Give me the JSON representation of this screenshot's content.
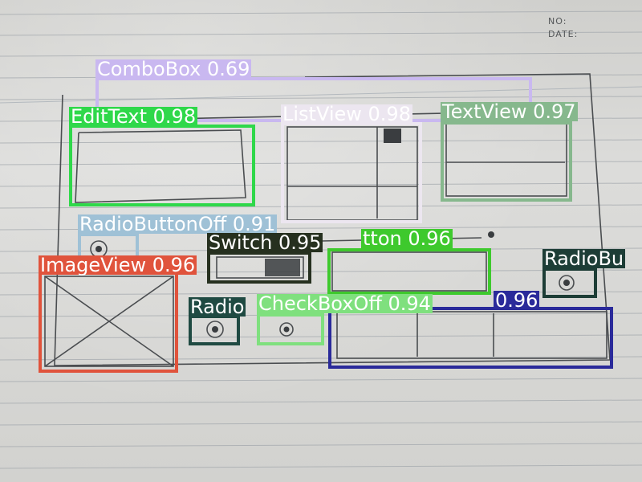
{
  "paper_header": {
    "no_label": "NO:",
    "date_label": "DATE:"
  },
  "detections": [
    {
      "id": "combobox",
      "label": "ComboBox",
      "score": "0.69",
      "text": "ComboBox 0.69",
      "color": "#c9b8f0",
      "text_color": "#ffffff"
    },
    {
      "id": "edittext",
      "label": "EditText",
      "score": "0.98",
      "text": "EditText 0.98",
      "color": "#2fd84a",
      "text_color": "#ffffff"
    },
    {
      "id": "listview",
      "label": "ListView",
      "score": "0.98",
      "text": "ListView 0.98",
      "color": "#ece6f0",
      "text_color": "#ffffff"
    },
    {
      "id": "textview",
      "label": "TextView",
      "score": "0.97",
      "text": "TextView 0.97",
      "color": "#86b88d",
      "text_color": "#ffffff"
    },
    {
      "id": "radiobuttonoff-top",
      "label": "RadioButtonOff",
      "score": "0.91",
      "text": "RadioButtonOff 0.91",
      "color": "#9fc1d6",
      "text_color": "#ffffff"
    },
    {
      "id": "switch",
      "label": "Switch",
      "score": "0.95",
      "text": "Switch 0.95",
      "color": "#26301f",
      "text_color": "#ffffff"
    },
    {
      "id": "button",
      "label": "Button",
      "score": "0.96",
      "text": "tton 0.96",
      "color": "#3ec92d",
      "text_color": "#ffffff"
    },
    {
      "id": "radiobutton-right",
      "label": "RadioButton",
      "score": "",
      "text": "RadioBu",
      "color": "#1d3d36",
      "text_color": "#ffffff"
    },
    {
      "id": "imageview",
      "label": "ImageView",
      "score": "0.96",
      "text": "ImageView 0.96",
      "color": "#e0533c",
      "text_color": "#ffffff"
    },
    {
      "id": "radio-left",
      "label": "Radio",
      "score": "",
      "text": "Radio",
      "color": "#1f4a42",
      "text_color": "#ffffff"
    },
    {
      "id": "checkboxoff",
      "label": "CheckBoxOff",
      "score": "0.94",
      "text": "CheckBoxOff 0.94",
      "color": "#7fe07e",
      "text_color": "#ffffff"
    },
    {
      "id": "bar-bottom",
      "label": "",
      "score": "0.96",
      "text": "0.96",
      "color": "#2a2a9a",
      "text_color": "#ffffff"
    }
  ]
}
